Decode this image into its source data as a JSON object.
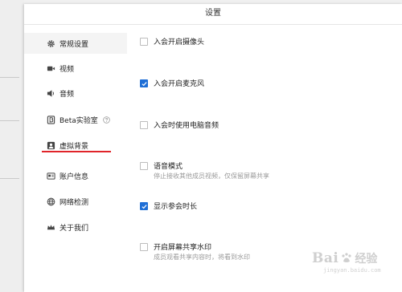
{
  "window": {
    "title": "设置"
  },
  "sidebar": {
    "items": [
      {
        "label": "常规设置",
        "icon": "gear-icon"
      },
      {
        "label": "视频",
        "icon": "video-camera-icon"
      },
      {
        "label": "音频",
        "icon": "speaker-icon"
      },
      {
        "label": "Beta实验室",
        "icon": "beta-flask-icon",
        "help_icon": "help-circle-icon"
      },
      {
        "label": "虚拟背景",
        "icon": "portrait-icon"
      },
      {
        "label": "账户信息",
        "icon": "account-card-icon"
      },
      {
        "label": "网络检测",
        "icon": "globe-icon"
      },
      {
        "label": "关于我们",
        "icon": "crown-icon"
      }
    ],
    "active_index": 0,
    "highlight_underline_color": "#e0242a"
  },
  "settings": {
    "options": [
      {
        "label": "入会开启摄像头",
        "checked": false
      },
      {
        "label": "入会开启麦克风",
        "checked": true
      },
      {
        "label": "入会时使用电脑音频",
        "checked": false
      },
      {
        "label": "语音模式",
        "description": "停止接收其他成员视频，仅保留屏幕共享",
        "checked": false
      },
      {
        "label": "显示参会时长",
        "checked": true
      },
      {
        "label": "开启屏幕共享水印",
        "description": "成员观看共享内容时，将看到水印",
        "checked": false
      }
    ],
    "accent_color": "#1f6fd6"
  },
  "watermark": {
    "logo_text": "Bai",
    "logo_suffix": "经验",
    "url": "jingyan.baidu.com",
    "icon": "paw-icon"
  }
}
